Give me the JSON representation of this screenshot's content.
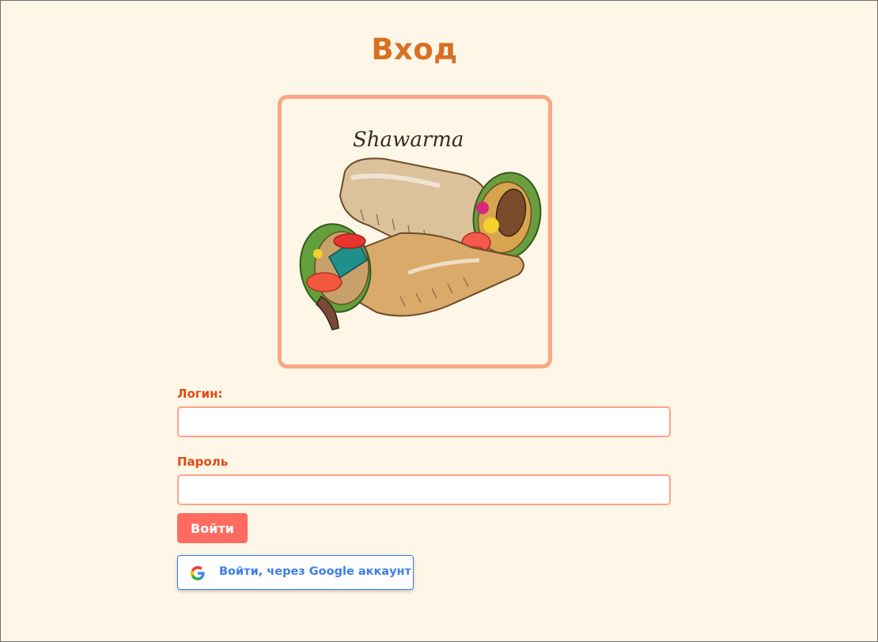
{
  "page": {
    "title": "Вход"
  },
  "logo": {
    "text": "Shawarma",
    "icon": "shawarma-illustration"
  },
  "form": {
    "login_label": "Логин:",
    "login_value": "",
    "password_label": "Пароль",
    "password_value": "",
    "submit_label": "Войти",
    "google_label": "Войти, через Google аккаунт",
    "google_icon": "google-icon"
  },
  "colors": {
    "background": "#fef6e7",
    "title": "#d87024",
    "accent_border": "#fca584",
    "label": "#e24a14",
    "submit_bg": "#fe6b61",
    "google_blue": "#3d7ee6"
  }
}
